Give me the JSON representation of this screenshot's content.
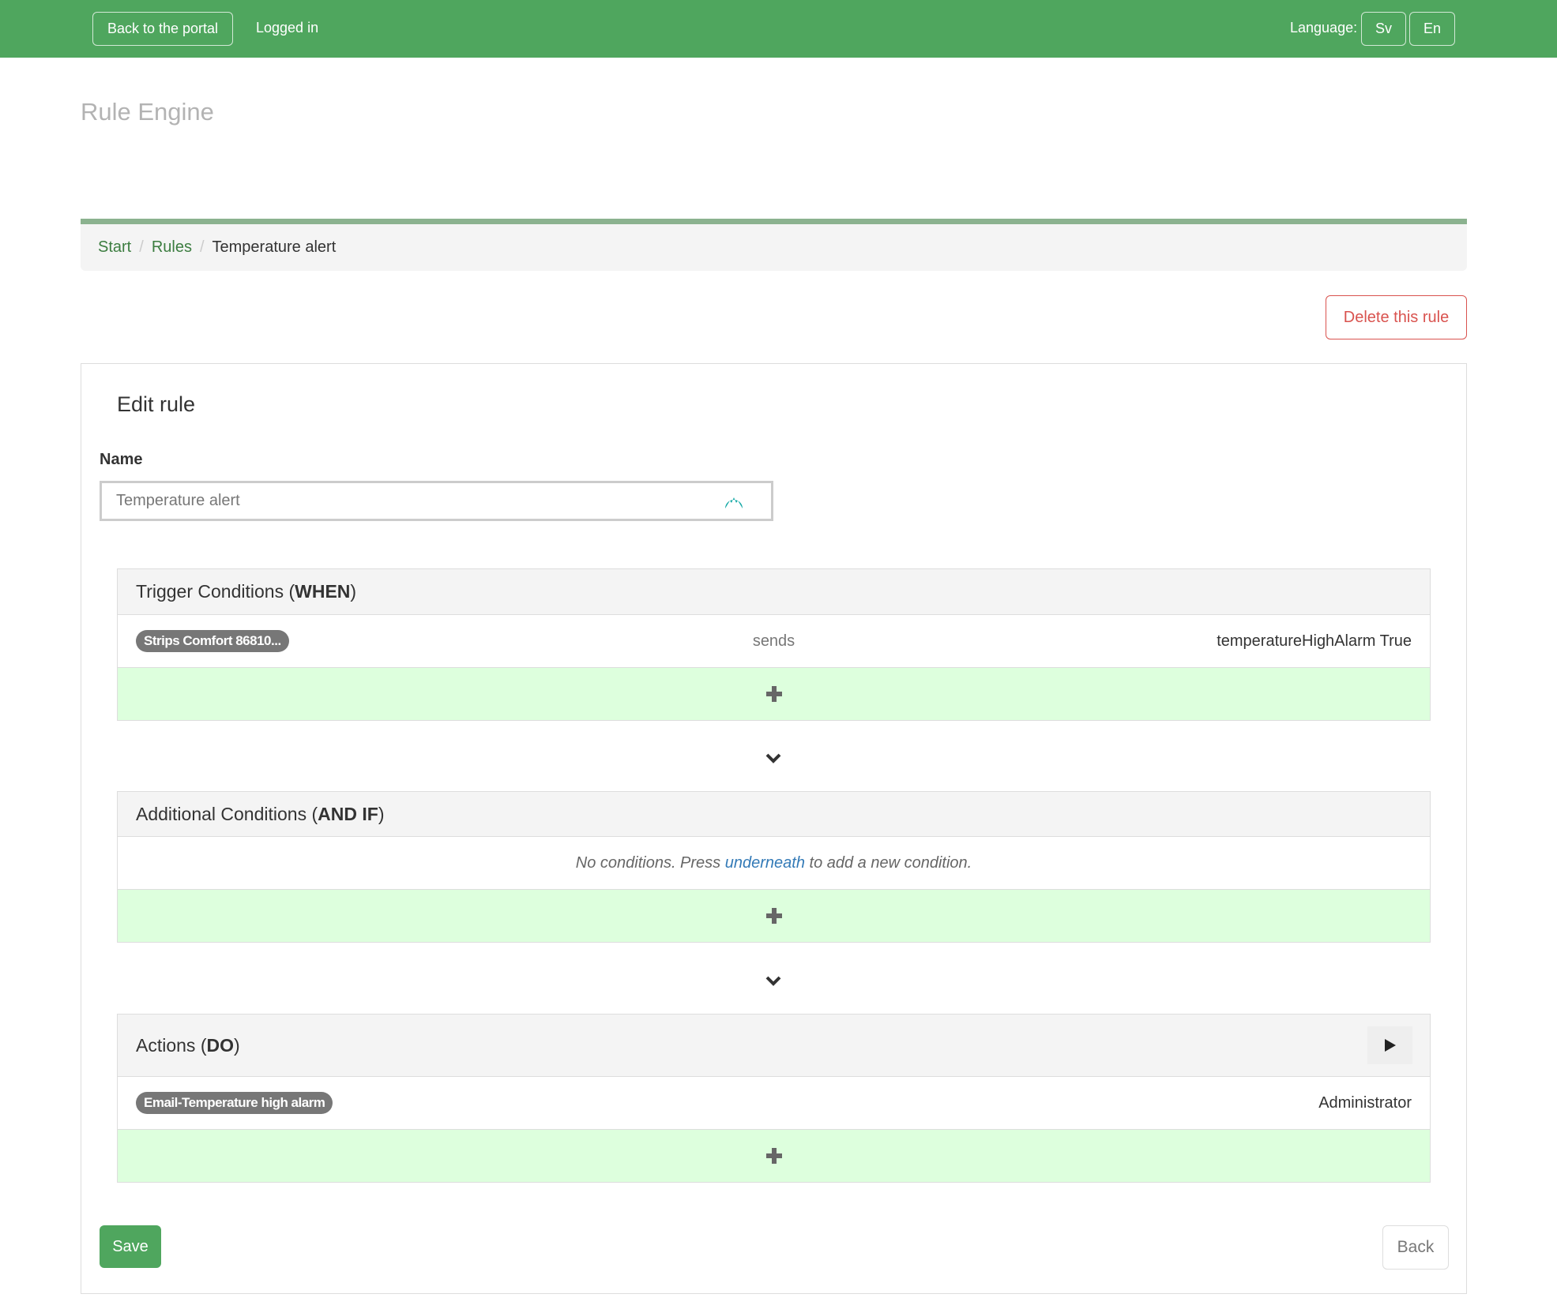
{
  "header": {
    "back_to_portal": "Back to the portal",
    "logged_in": "Logged in",
    "language_label": "Language:",
    "languages": [
      "Sv",
      "En"
    ],
    "bar_color": "#4fa65e"
  },
  "page_title": "Rule Engine",
  "breadcrumb": [
    "Start",
    "Rules",
    "Temperature alert"
  ],
  "delete_button": "Delete this rule",
  "form": {
    "heading": "Edit rule",
    "name_label": "Name",
    "name_value": "Temperature alert",
    "password_manager_icon": "nordpass-icon"
  },
  "sections": {
    "trigger": {
      "title_prefix": "Trigger Conditions (",
      "title_bold": "WHEN",
      "title_suffix": ")",
      "rows": [
        {
          "device": "Strips Comfort 86810...",
          "verb": "sends",
          "value": "temperatureHighAlarm True"
        }
      ],
      "add_icon": "plus-icon"
    },
    "additional": {
      "title_prefix": "Additional Conditions (",
      "title_bold": "AND IF",
      "title_suffix": ")",
      "empty_before": "No conditions. Press ",
      "empty_link": "underneath",
      "empty_after": " to add a new condition.",
      "add_icon": "plus-icon"
    },
    "actions": {
      "title_prefix": "Actions (",
      "title_bold": "DO",
      "title_suffix": ")",
      "run_icon": "play-icon",
      "rows": [
        {
          "action": "Email-Temperature high alarm",
          "recipient": "Administrator"
        }
      ],
      "add_icon": "plus-icon"
    }
  },
  "flow_icon": "chevron-down-icon",
  "save_button": "Save",
  "back_button": "Back",
  "colors": {
    "link_green": "#3c7d40",
    "danger": "#d9534f",
    "add_row_bg": "#ddffdd",
    "link_blue": "#337ab7"
  }
}
